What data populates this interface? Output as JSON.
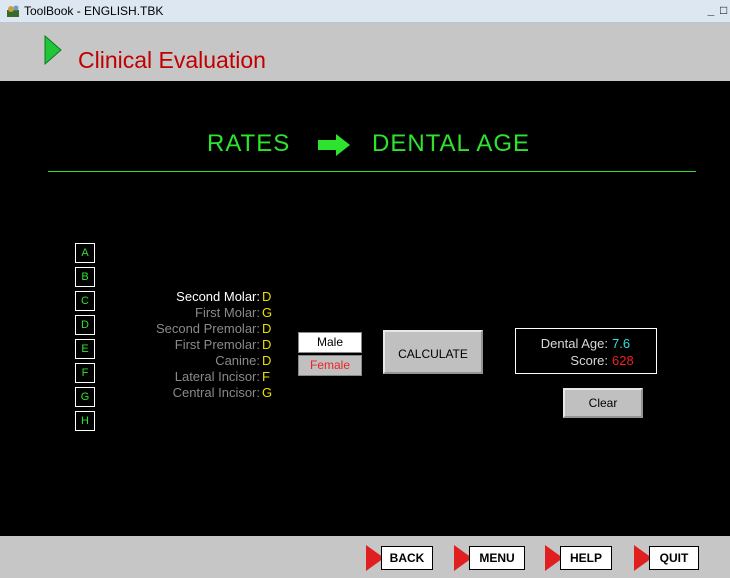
{
  "window": {
    "title": "ToolBook - ENGLISH.TBK",
    "minimize_label": "_",
    "restore_label": "□"
  },
  "header": {
    "title": "Clinical Evaluation"
  },
  "banner": {
    "left": "RATES",
    "right": "DENTAL AGE"
  },
  "stage_buttons": [
    "A",
    "B",
    "C",
    "D",
    "E",
    "F",
    "G",
    "H"
  ],
  "teeth": [
    {
      "name": "Second Molar:",
      "grade": "D",
      "active": true
    },
    {
      "name": "First Molar:",
      "grade": "G",
      "active": false
    },
    {
      "name": "Second Premolar:",
      "grade": "D",
      "active": false
    },
    {
      "name": "First Premolar:",
      "grade": "D",
      "active": false
    },
    {
      "name": "Canine:",
      "grade": "D",
      "active": false
    },
    {
      "name": "Lateral Incisor:",
      "grade": "F",
      "active": false
    },
    {
      "name": "Central Incisor:",
      "grade": "G",
      "active": false
    }
  ],
  "sex": {
    "male": "Male",
    "female": "Female",
    "selected": "Female"
  },
  "calculate_label": "CALCULATE",
  "result": {
    "age_label": "Dental Age:",
    "age_value": "7.6",
    "score_label": "Score:",
    "score_value": "628"
  },
  "clear_label": "Clear",
  "footer": {
    "back": "BACK",
    "menu": "MENU",
    "help": "HELP",
    "quit": "QUIT"
  },
  "colors": {
    "accent_green": "#2ee32e",
    "title_red": "#c00000",
    "grade_yellow": "#e8e000",
    "age_cyan": "#33dddd",
    "score_red": "#ee2222",
    "nav_red": "#e02020"
  }
}
